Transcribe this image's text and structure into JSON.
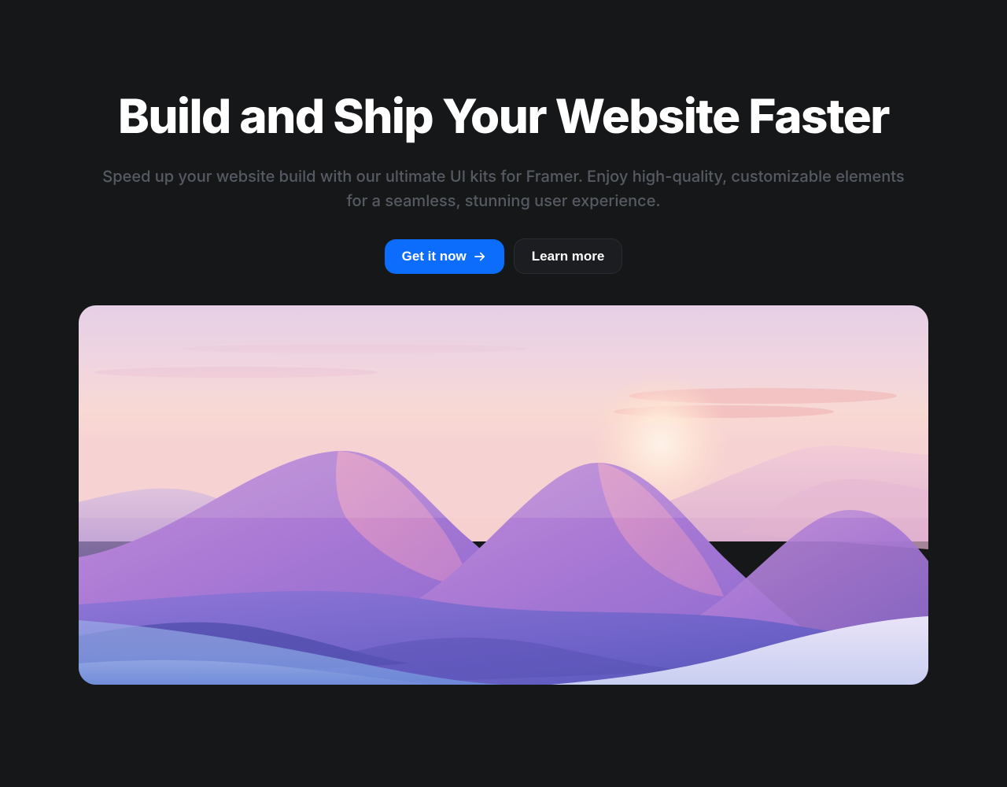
{
  "hero": {
    "title": "Build and Ship Your Website Faster",
    "subtitle": "Speed up your website build with our ultimate UI kits for Framer. Enjoy high-quality, customizable elements for a seamless, stunning user experience.",
    "primary_button": "Get it now",
    "secondary_button": "Learn more"
  },
  "colors": {
    "background": "#161719",
    "primary_button": "#0c6dfd",
    "text_primary": "#ffffff",
    "text_muted": "#565a63"
  }
}
